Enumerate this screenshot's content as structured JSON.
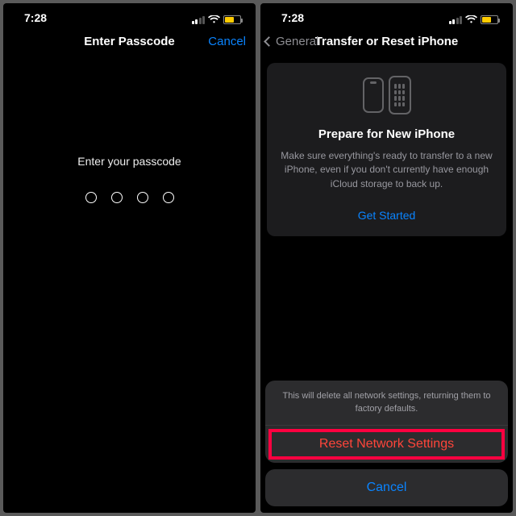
{
  "status": {
    "time": "7:28"
  },
  "left": {
    "nav": {
      "title": "Enter Passcode",
      "cancel": "Cancel"
    },
    "prompt": "Enter your passcode",
    "digits": 4
  },
  "right": {
    "nav": {
      "back": "General",
      "title": "Transfer or Reset iPhone"
    },
    "card": {
      "title": "Prepare for New iPhone",
      "body": "Make sure everything's ready to transfer to a new iPhone, even if you don't currently have enough iCloud storage to back up.",
      "cta": "Get Started"
    },
    "sheet": {
      "message": "This will delete all network settings, returning them to factory defaults.",
      "action": "Reset Network Settings",
      "cancel": "Cancel"
    }
  }
}
